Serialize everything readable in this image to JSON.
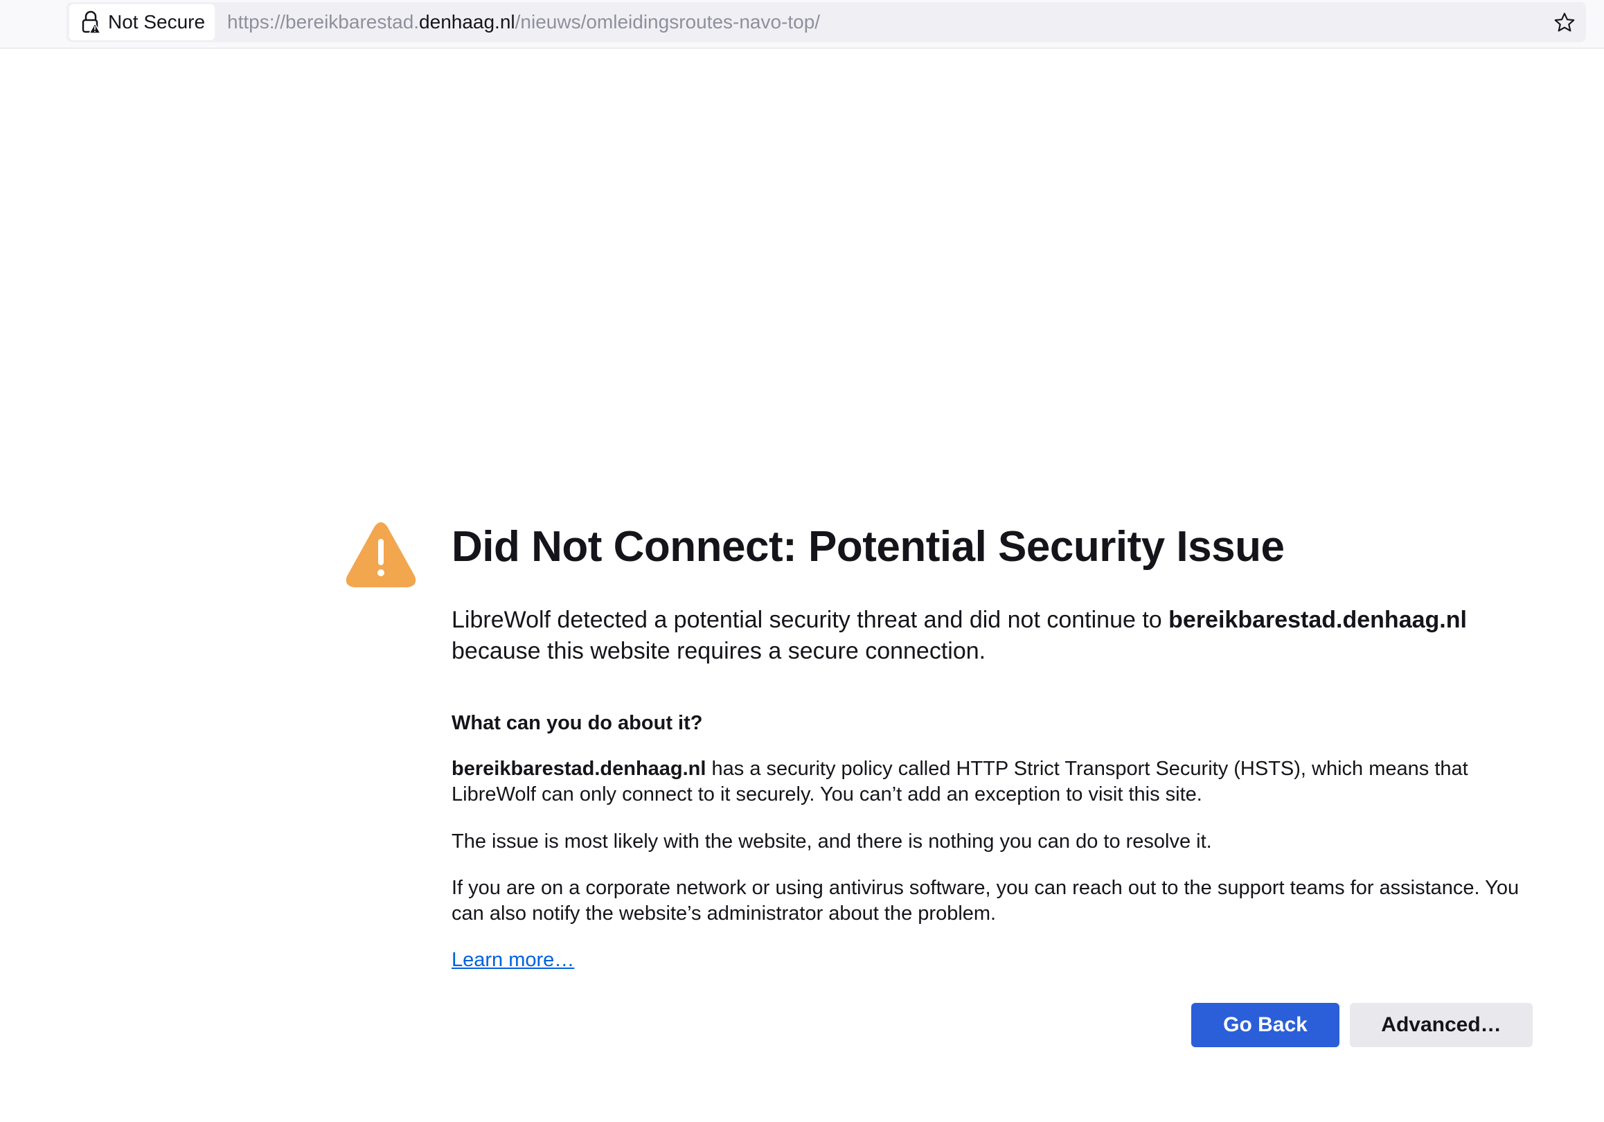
{
  "browser": {
    "identity_label": "Not Secure",
    "url": {
      "prefix": "https://bereikbarestad.",
      "host": "denhaag.nl",
      "path": "/nieuws/omleidingsroutes-navo-top/"
    },
    "icons": {
      "identity": "lock-warning-icon",
      "bookmark": "star-icon"
    }
  },
  "error": {
    "icon": "warning-triangle-icon",
    "title": "Did Not Connect: Potential Security Issue",
    "intro_before": "LibreWolf detected a potential security threat and did not continue to ",
    "intro_host": "bereikbarestad.denhaag.nl",
    "intro_after": " because this website requires a secure connection.",
    "section_title": "What can you do about it?",
    "p1_host": "bereikbarestad.denhaag.nl",
    "p1_text": " has a security policy called HTTP Strict Transport Security (HSTS), which means that LibreWolf can only connect to it securely. You can’t add an exception to visit this site.",
    "p2_text": "The issue is most likely with the website, and there is nothing you can do to resolve it.",
    "p3_text": "If you are on a corporate network or using antivirus software, you can reach out to the support teams for assistance. You can also notify the website’s administrator about the problem.",
    "learn_more": "Learn more…",
    "go_back_label": "Go Back",
    "advanced_label": "Advanced…"
  },
  "colors": {
    "warning": "#f2a64e",
    "primary_button": "#2b5fd9",
    "link": "#0061e0"
  }
}
